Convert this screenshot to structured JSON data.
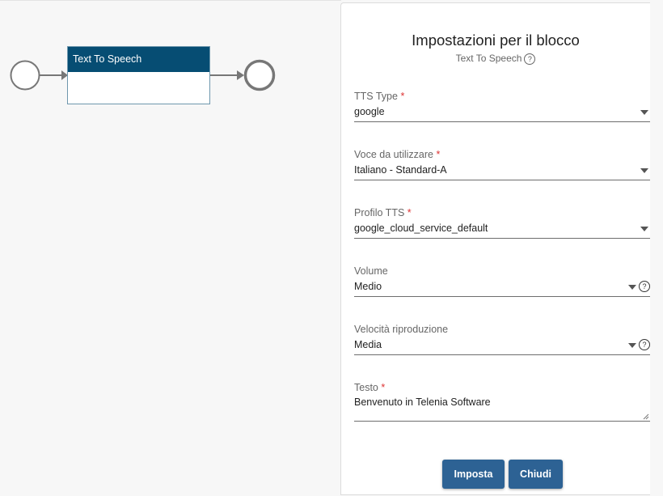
{
  "canvas": {
    "block": {
      "title": "Text To Speech"
    }
  },
  "panel": {
    "title": "Impostazioni per il blocco",
    "subtitle": "Text To Speech",
    "help_glyph": "?",
    "fields": [
      {
        "label": "TTS Type",
        "required": "*",
        "value": "google",
        "has_help": false
      },
      {
        "label": "Voce da utilizzare",
        "required": "*",
        "value": "Italiano - Standard-A",
        "has_help": false
      },
      {
        "label": "Profilo TTS",
        "required": "*",
        "value": "google_cloud_service_default",
        "has_help": false
      },
      {
        "label": "Volume",
        "required": "",
        "value": "Medio",
        "has_help": true
      },
      {
        "label": "Velocità riproduzione",
        "required": "",
        "value": "Media",
        "has_help": true
      }
    ],
    "text_field": {
      "label": "Testo",
      "required": "*",
      "value": "Benvenuto in Telenia Software"
    },
    "buttons": {
      "set": "Imposta",
      "close": "Chiudi"
    }
  },
  "colors": {
    "block_header": "#064d73",
    "button": "#2d6294",
    "required": "#dd3333"
  }
}
